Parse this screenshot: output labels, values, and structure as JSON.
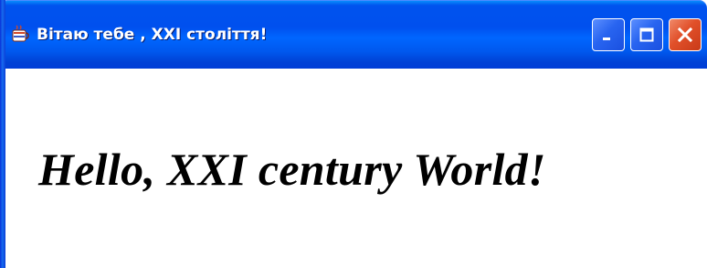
{
  "window": {
    "title": "Вітаю тебе , XXI століття!",
    "app_icon": "java-coffee-cup-icon",
    "controls": {
      "minimize": "minimize-icon",
      "maximize": "maximize-icon",
      "close": "close-icon"
    }
  },
  "content": {
    "message": "Hello, XXI century World!"
  },
  "colors": {
    "titlebar": "#0054e3",
    "close_button": "#e1502a",
    "text": "#000000",
    "background": "#ffffff"
  }
}
